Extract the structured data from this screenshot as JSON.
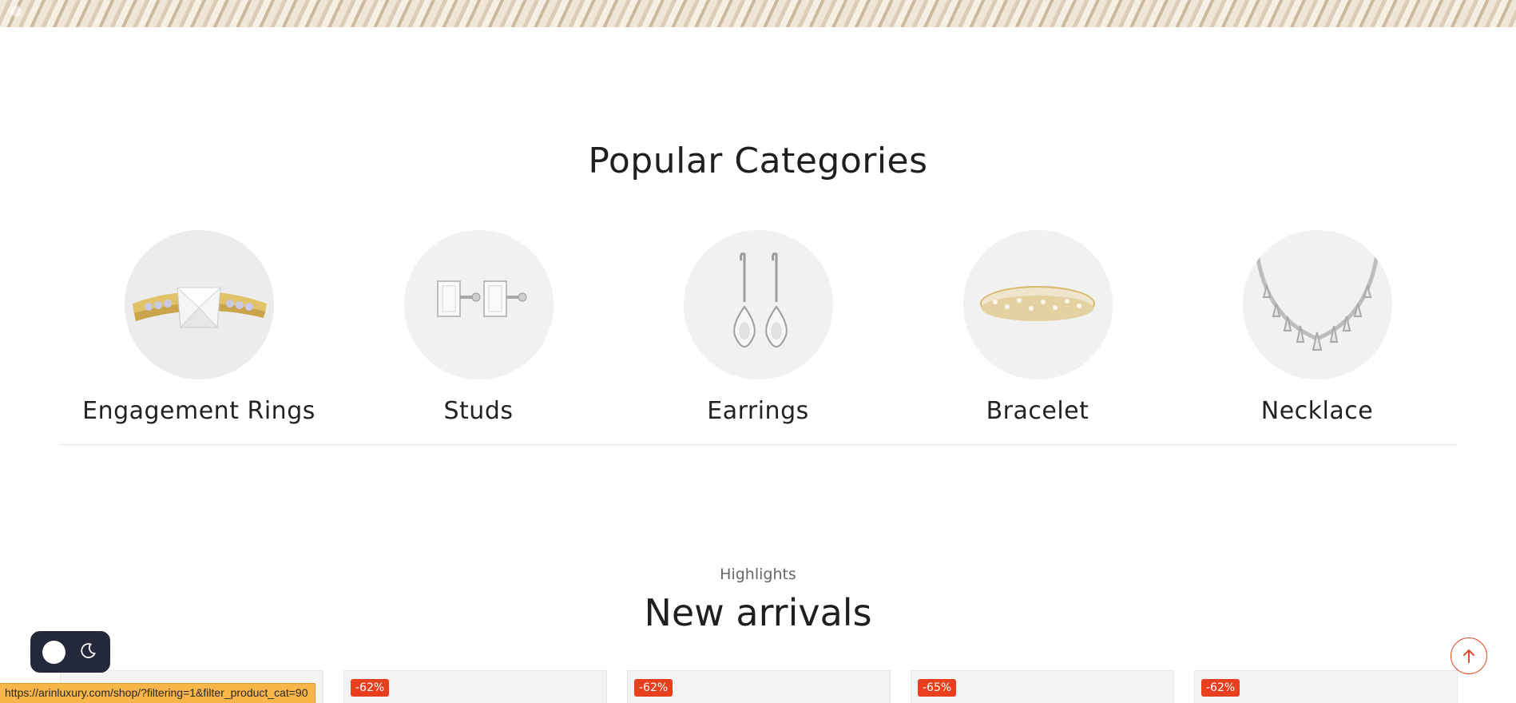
{
  "popular": {
    "title": "Popular Categories",
    "categories": [
      {
        "label": "Engagement Rings",
        "icon": "engagement-ring-image"
      },
      {
        "label": "Studs",
        "icon": "studs-image"
      },
      {
        "label": "Earrings",
        "icon": "earrings-image"
      },
      {
        "label": "Bracelet",
        "icon": "bracelet-image"
      },
      {
        "label": "Necklace",
        "icon": "necklace-image"
      }
    ]
  },
  "arrivals": {
    "eyebrow": "Highlights",
    "title": "New arrivals",
    "products": [
      {
        "badge": ""
      },
      {
        "badge": "-62%"
      },
      {
        "badge": "-62%"
      },
      {
        "badge": "-65%"
      },
      {
        "badge": "-62%"
      }
    ]
  },
  "status_bar": {
    "url": "https://arinluxury.com/shop/?filtering=1&filter_product_cat=90"
  },
  "colors": {
    "accent": "#e8401e",
    "toggle_bg": "#23293a",
    "status_bg": "#f7b54a"
  },
  "icons": {
    "theme_toggle": "moon-icon",
    "back_to_top": "arrow-up-icon"
  }
}
